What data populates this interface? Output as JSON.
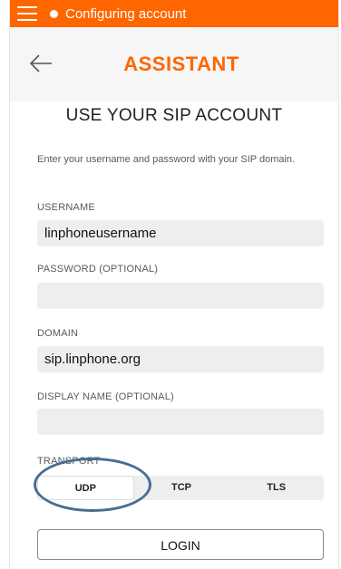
{
  "status_bar": {
    "text": "Configuring account",
    "color": "#ff6600"
  },
  "header": {
    "title": "ASSISTANT",
    "back_icon": "arrow-left-icon",
    "accent": "#ff6600"
  },
  "page": {
    "title": "USE YOUR SIP ACCOUNT",
    "instructions": "Enter your username and password with your SIP domain."
  },
  "form": {
    "username": {
      "label": "USERNAME",
      "value": "linphoneusername"
    },
    "password": {
      "label": "PASSWORD (OPTIONAL)",
      "value": ""
    },
    "domain": {
      "label": "DOMAIN",
      "value": "sip.linphone.org"
    },
    "display_name": {
      "label": "DISPLAY NAME (OPTIONAL)",
      "value": ""
    },
    "transport": {
      "label": "TRANSPORT",
      "options": [
        "UDP",
        "TCP",
        "TLS"
      ],
      "selected": "UDP"
    }
  },
  "login_button": "LOGIN"
}
